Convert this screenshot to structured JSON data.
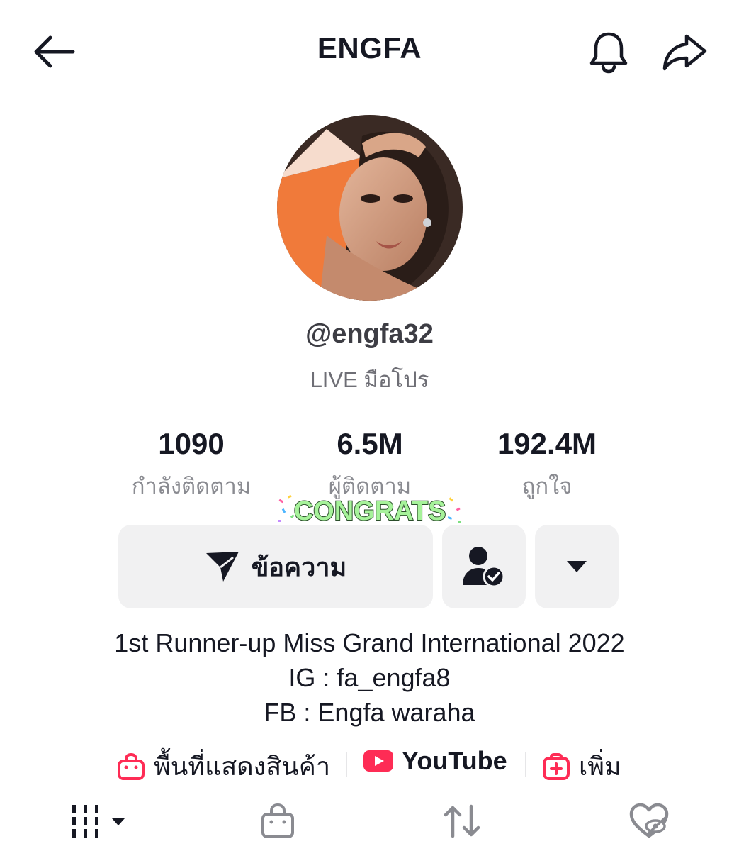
{
  "header": {
    "title": "ENGFA",
    "icons": [
      "back-arrow-icon",
      "bell-icon",
      "share-icon"
    ]
  },
  "profile": {
    "username": "@engfa32",
    "subtitle": "LIVE มือโปร",
    "sticker_text": "CONGRATS"
  },
  "stats": [
    {
      "value": "1090",
      "label": "กำลังติดตาม"
    },
    {
      "value": "6.5M",
      "label": "ผู้ติดตาม"
    },
    {
      "value": "192.4M",
      "label": "ถูกใจ"
    }
  ],
  "actions": {
    "message_label": "ข้อความ"
  },
  "bio": {
    "line1": "1st Runner-up Miss Grand International 2022",
    "line2": "IG : fa_engfa8",
    "line3": "FB : Engfa waraha"
  },
  "links": {
    "shop": "พื้นที่แสดงสินค้า",
    "youtube": "YouTube",
    "add": "เพิ่ม"
  },
  "colors": {
    "accent": "#fe2c55",
    "button_bg": "#f1f1f2",
    "text": "#161823",
    "secondary_text": "#8a8b91",
    "sticker_green": "#a6f29a"
  }
}
